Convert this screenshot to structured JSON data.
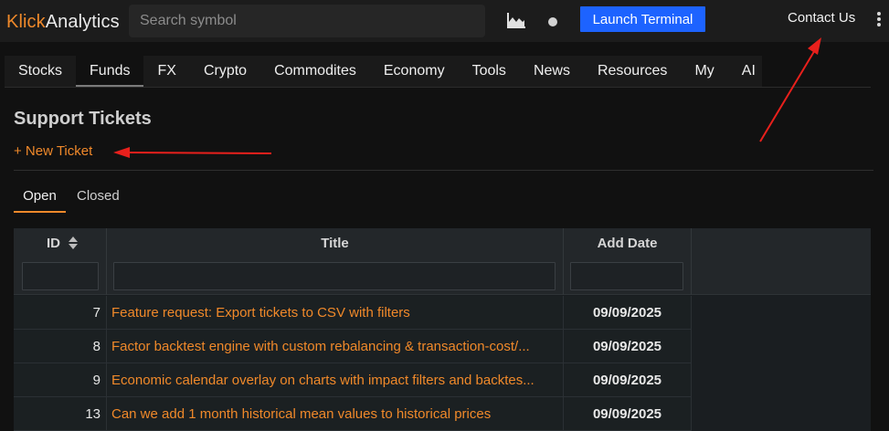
{
  "header": {
    "logo_part1": "Klick",
    "logo_part2": "Analytics",
    "search_placeholder": "Search symbol",
    "chart_icon": "area-chart-icon",
    "status_icon": "status-dot-icon",
    "launch_label": "Launch Terminal",
    "contact_label": "Contact Us",
    "menu_icon": "kebab-menu-icon"
  },
  "nav": {
    "items": [
      {
        "label": "Stocks"
      },
      {
        "label": "Funds"
      },
      {
        "label": "FX"
      },
      {
        "label": "Crypto"
      },
      {
        "label": "Commodites"
      },
      {
        "label": "Economy"
      },
      {
        "label": "Tools"
      },
      {
        "label": "News"
      },
      {
        "label": "Resources"
      },
      {
        "label": "My"
      },
      {
        "label": "AI"
      }
    ],
    "active": "Funds"
  },
  "page": {
    "title": "Support Tickets",
    "new_ticket_label": "+ New Ticket"
  },
  "tabs": {
    "open_label": "Open",
    "closed_label": "Closed",
    "active": "Open"
  },
  "table": {
    "columns": {
      "id": "ID",
      "title": "Title",
      "add_date": "Add Date"
    },
    "sort_icon": "sort-up-down-icon",
    "rows": [
      {
        "id": "7",
        "title": "Feature request: Export tickets to CSV with filters",
        "date": "09/09/2025"
      },
      {
        "id": "8",
        "title": "Factor backtest engine with custom rebalancing & transaction-cost/...",
        "date": "09/09/2025"
      },
      {
        "id": "9",
        "title": "Economic calendar overlay on charts with impact filters and backtes...",
        "date": "09/09/2025"
      },
      {
        "id": "13",
        "title": "Can we add 1 month historical mean values to historical prices",
        "date": "09/09/2025"
      }
    ]
  },
  "colors": {
    "accent": "#f0892a",
    "launch_button": "#1d63ff",
    "annotation_arrow": "#e8201c"
  }
}
